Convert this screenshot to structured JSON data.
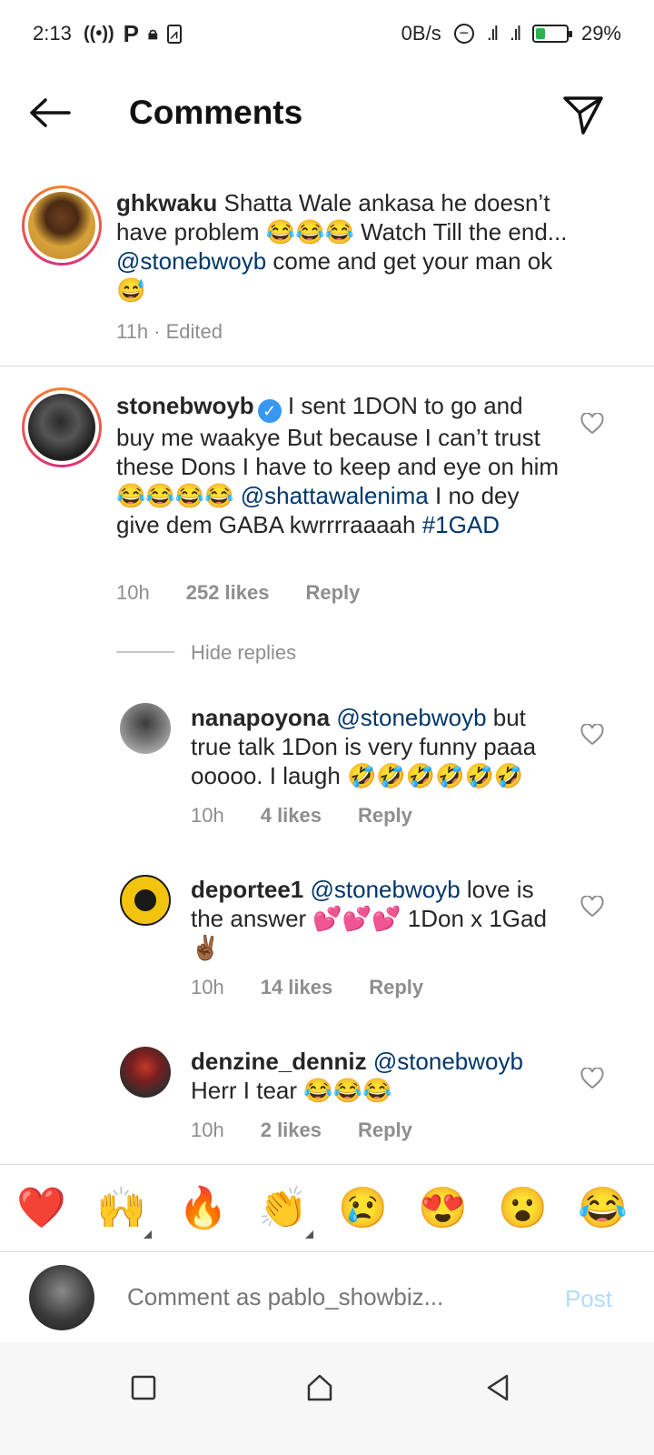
{
  "status": {
    "time": "2:13",
    "net_speed": "0B/s",
    "battery": "29%",
    "battery_level": 0.29
  },
  "header": {
    "title": "Comments"
  },
  "main_comment": {
    "username": "ghkwaku",
    "text_1": "Shatta Wale ankasa he doesn’t have problem 😂😂😂 Watch Till the end... ",
    "mention": "@stonebwoyb",
    "text_2": " come and get your man ok 😅",
    "meta": "11h · Edited"
  },
  "comment_1": {
    "username": "stonebwoyb",
    "text_1": " I sent 1DON to go and buy me waakye But because I can’t trust these Dons I have to keep and eye on him 😂😂😂😂 ",
    "mention": "@shattawalenima",
    "text_2": " I no dey give dem GABA kwrrrraaaah ",
    "hashtag": "#1GAD",
    "time": "10h",
    "likes": "252 likes",
    "reply": "Reply",
    "hide_replies": "Hide replies"
  },
  "replies": [
    {
      "username": "nanapoyona",
      "mention": "@stonebwoyb",
      "text": " but true talk 1Don is very funny paaa ooooo. I laugh 🤣🤣🤣🤣🤣🤣",
      "time": "10h",
      "likes": "4 likes",
      "reply": "Reply"
    },
    {
      "username": "deportee1",
      "mention": "@stonebwoyb",
      "text": "  love is the answer 💕💕💕 1Don x 1Gad ✌🏾",
      "time": "10h",
      "likes": "14 likes",
      "reply": "Reply"
    },
    {
      "username": "denzine_denniz",
      "mention": "@stonebwoyb",
      "text": " Herr I tear 😂😂😂",
      "time": "10h",
      "likes": "2 likes",
      "reply": "Reply"
    }
  ],
  "emoji_bar": [
    "❤️",
    "🙌",
    "🔥",
    "👏",
    "😢",
    "😍",
    "😮",
    "😂"
  ],
  "comment_input": {
    "placeholder": "Comment as pablo_showbiz...",
    "post_label": "Post"
  }
}
